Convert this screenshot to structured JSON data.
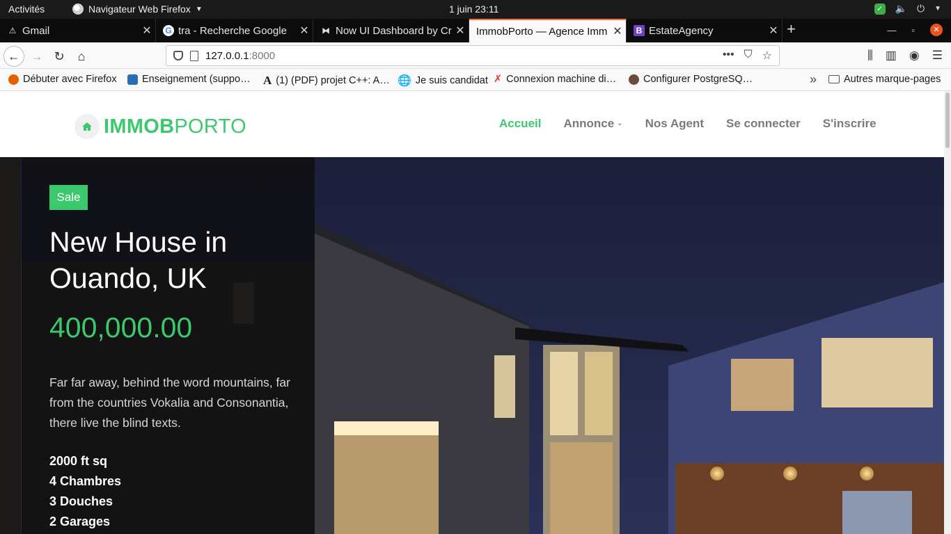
{
  "system": {
    "activities": "Activités",
    "app_name": "Navigateur Web Firefox",
    "clock": "1 juin  23:11"
  },
  "tabs": [
    {
      "label": "Gmail",
      "icon": "gmail-icon"
    },
    {
      "label": "tra - Recherche Google",
      "icon": "google-icon"
    },
    {
      "label": "Now UI Dashboard by Cr",
      "icon": "creative-tim-icon"
    },
    {
      "label": "ImmobPorto — Agence Imm",
      "icon": "site-icon",
      "active": true
    },
    {
      "label": "EstateAgency",
      "icon": "bootstrap-icon"
    }
  ],
  "url": {
    "host": "127.0.0.1",
    "port": ":8000"
  },
  "bookmarks": [
    {
      "label": "Débuter avec Firefox",
      "icon": "firefox-icon",
      "color": "#e66000"
    },
    {
      "label": "Enseignement (suppo…",
      "icon": "book-icon",
      "color": "#2a6fb5"
    },
    {
      "label": "(1) (PDF) projet C++: A…",
      "icon": "academia-icon",
      "color": "#111111"
    },
    {
      "label": "Je suis candidat",
      "icon": "globe-icon",
      "color": "#555555"
    },
    {
      "label": "Connexion machine di…",
      "icon": "tools-icon",
      "color": "#d9412c"
    },
    {
      "label": "Configurer PostgreSQ…",
      "icon": "elephant-icon",
      "color": "#6b4c3b"
    }
  ],
  "bookmarks_other": "Autres marque-pages",
  "site": {
    "brand_bold": "IMMOB",
    "brand_light": "PORTO",
    "menu": [
      "Accueil",
      "Annonce",
      "Nos Agent",
      "Se connecter",
      "S'inscrire"
    ],
    "accent": "#3cc86d"
  },
  "hero": {
    "badge": "Sale",
    "title": "New House in Ouando, UK",
    "price": "400,000.00",
    "description": "Far far away, behind the word mountains, far from the countries Vokalia and Consonantia, there live the blind texts.",
    "features": [
      "2000 ft sq",
      "4 Chambres",
      "3 Douches",
      "2 Garages"
    ]
  }
}
